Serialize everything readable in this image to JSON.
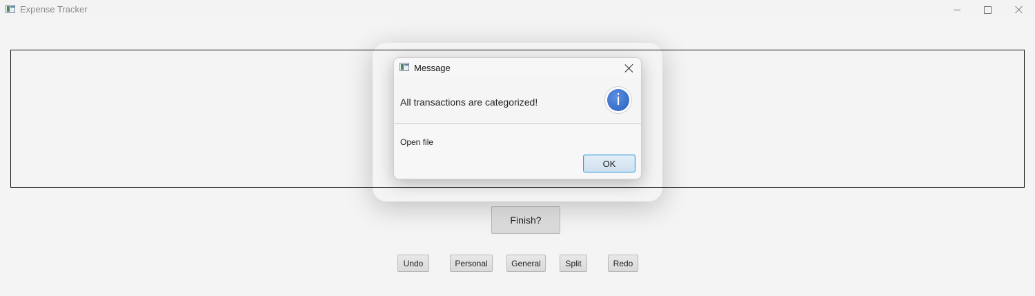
{
  "window": {
    "title": "Expense Tracker"
  },
  "main": {
    "finish_label": "Finish?",
    "buttons": {
      "undo": "Undo",
      "personal": "Personal",
      "general": "General",
      "split": "Split",
      "redo": "Redo"
    }
  },
  "dialog": {
    "title": "Message",
    "message": "All transactions are categorized!",
    "info_glyph": "i",
    "content": "Open file",
    "ok_label": "OK"
  },
  "icons": {
    "app": "app-icon",
    "info": "info-icon",
    "minimize": "minimize-icon",
    "maximize": "maximize-icon",
    "close": "close-icon"
  },
  "colors": {
    "accent": "#3a9ad9",
    "info_blue": "#2a5fbf"
  }
}
